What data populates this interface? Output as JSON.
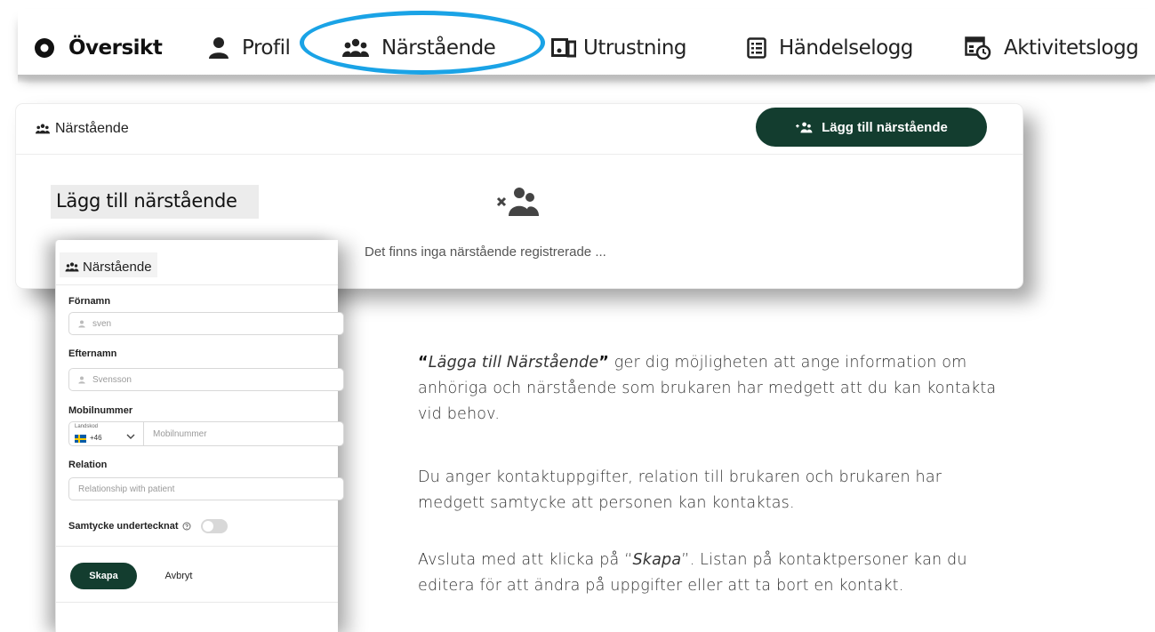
{
  "nav": {
    "items": [
      {
        "label": "Översikt",
        "icon": "eye-circle-icon",
        "active": true
      },
      {
        "label": "Profil",
        "icon": "person-icon",
        "active": false
      },
      {
        "label": "Närstående",
        "icon": "group-icon",
        "active": false,
        "highlighted": true
      },
      {
        "label": "Utrustning",
        "icon": "devices-icon",
        "active": false
      },
      {
        "label": "Händelselogg",
        "icon": "list-icon",
        "active": false
      },
      {
        "label": "Aktivitetslogg",
        "icon": "calendar-clock-icon",
        "active": false
      }
    ],
    "highlight_color": "#1aa3e6"
  },
  "card": {
    "title": "Närstående",
    "add_button_label": "Lägg till närstående",
    "empty_message": "Det finns inga närstående registrerade ..."
  },
  "modal": {
    "title": "Lägg till närstående",
    "section_title": "Närstående",
    "fields": {
      "first_name": {
        "label": "Förnamn",
        "placeholder": "sven"
      },
      "last_name": {
        "label": "Efternamn",
        "placeholder": "Svensson"
      },
      "mobile": {
        "label": "Mobilnummer",
        "country_label": "Landskod",
        "country_code": "+46",
        "placeholder": "Mobilnummer"
      },
      "relation": {
        "label": "Relation",
        "placeholder": "Relationship with patient"
      },
      "consent": {
        "label": "Samtycke undertecknat"
      }
    },
    "create_label": "Skapa",
    "cancel_label": "Avbryt"
  },
  "description": {
    "p1_quote_open": "“",
    "p1_em": "Lägga till Närstående",
    "p1_quote_close": "”",
    "p1_rest_line1": " ger dig möjligheten att ange information om",
    "p1_line2": "anhöriga och närstående som brukaren har medgett att du kan kontakta",
    "p1_line3": "vid behov.",
    "p2_line1": "Du anger kontaktuppgifter, relation till brukaren och brukaren har",
    "p2_line2": "medgett samtycke att personen kan kontaktas.",
    "p3_line1_pre": "Avsluta med att klicka på “",
    "p3_em": "Skapa",
    "p3_line1_post": "”. Listan på kontaktpersoner kan du",
    "p3_line2": "editera för att ändra på uppgifter eller att ta bort en kontakt."
  },
  "colors": {
    "primary_button": "#133d2f",
    "highlight": "#1aa3e6"
  }
}
